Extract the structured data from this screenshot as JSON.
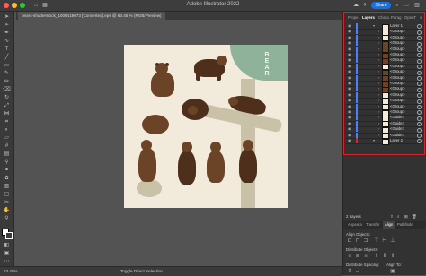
{
  "app_title": "Adobe Illustrator 2022",
  "share_label": "Share",
  "document_tab": "bears-shutterstock_1009419073 [Converted].eps @ 63.45 % (RGB/Preview)",
  "artboard": {
    "title_letters": [
      "B",
      "E",
      "A",
      "R"
    ]
  },
  "toolbar": {
    "tools": [
      "selection-tool",
      "direct-selection-tool",
      "pen-tool",
      "curvature-tool",
      "type-tool",
      "line-tool",
      "rectangle-tool",
      "paintbrush-tool",
      "pencil-tool",
      "eraser-tool",
      "rotate-tool",
      "scale-tool",
      "width-tool",
      "free-transform-tool",
      "shape-builder-tool",
      "perspective-tool",
      "mesh-tool",
      "gradient-tool",
      "eyedropper-tool",
      "blend-tool",
      "symbol-sprayer-tool",
      "graph-tool",
      "artboard-tool",
      "slice-tool",
      "hand-tool",
      "zoom-tool"
    ]
  },
  "status": {
    "zoom": "63.45%",
    "tool": "Toggle Direct Selection"
  },
  "panel_tabs": [
    "Prope",
    "Layers",
    "Chara",
    "Parag",
    "OpenT"
  ],
  "layers": [
    {
      "name": "Layer 1",
      "level": 0,
      "thumb": "light"
    },
    {
      "name": "<Group>",
      "level": 1,
      "thumb": "light"
    },
    {
      "name": "<Group>",
      "level": 1,
      "thumb": "light"
    },
    {
      "name": "<Group>",
      "level": 1,
      "thumb": "bear"
    },
    {
      "name": "<Group>",
      "level": 1,
      "thumb": "bear"
    },
    {
      "name": "<Group>",
      "level": 1,
      "thumb": "bear"
    },
    {
      "name": "<Group>",
      "level": 1,
      "thumb": "bear"
    },
    {
      "name": "<Group>",
      "level": 1,
      "thumb": "light"
    },
    {
      "name": "<Group>",
      "level": 1,
      "thumb": "bear"
    },
    {
      "name": "<Group>",
      "level": 1,
      "thumb": "bear"
    },
    {
      "name": "<Group>",
      "level": 1,
      "thumb": "bear"
    },
    {
      "name": "<Group>",
      "level": 1,
      "thumb": "bear"
    },
    {
      "name": "<Group>",
      "level": 1,
      "thumb": "light"
    },
    {
      "name": "<Group>",
      "level": 1,
      "thumb": "light"
    },
    {
      "name": "<Group>",
      "level": 1,
      "thumb": "light"
    },
    {
      "name": "<Group>",
      "level": 1,
      "thumb": "light"
    },
    {
      "name": "<Guide>",
      "level": 1,
      "thumb": "light"
    },
    {
      "name": "<Guide>",
      "level": 1,
      "thumb": "light"
    },
    {
      "name": "<Guide>",
      "level": 1,
      "thumb": "light"
    },
    {
      "name": "<Guide>",
      "level": 1,
      "thumb": "light"
    },
    {
      "name": "Layer 2",
      "level": 0,
      "thumb": "light"
    }
  ],
  "layers_count": "2 Layers",
  "lower_tabs": [
    "Appeara",
    "Transfor",
    "Align",
    "Pathfinde"
  ],
  "align_sections": [
    "Align Objects:",
    "Distribute Objects:",
    "Distribute Spacing:",
    "Align To:"
  ],
  "colors": {
    "accent": "#1473e6",
    "highlight": "#d6262b",
    "layer_bar": "#4a80ff",
    "artboard": "#f2eada",
    "bear": "#6b4428"
  }
}
